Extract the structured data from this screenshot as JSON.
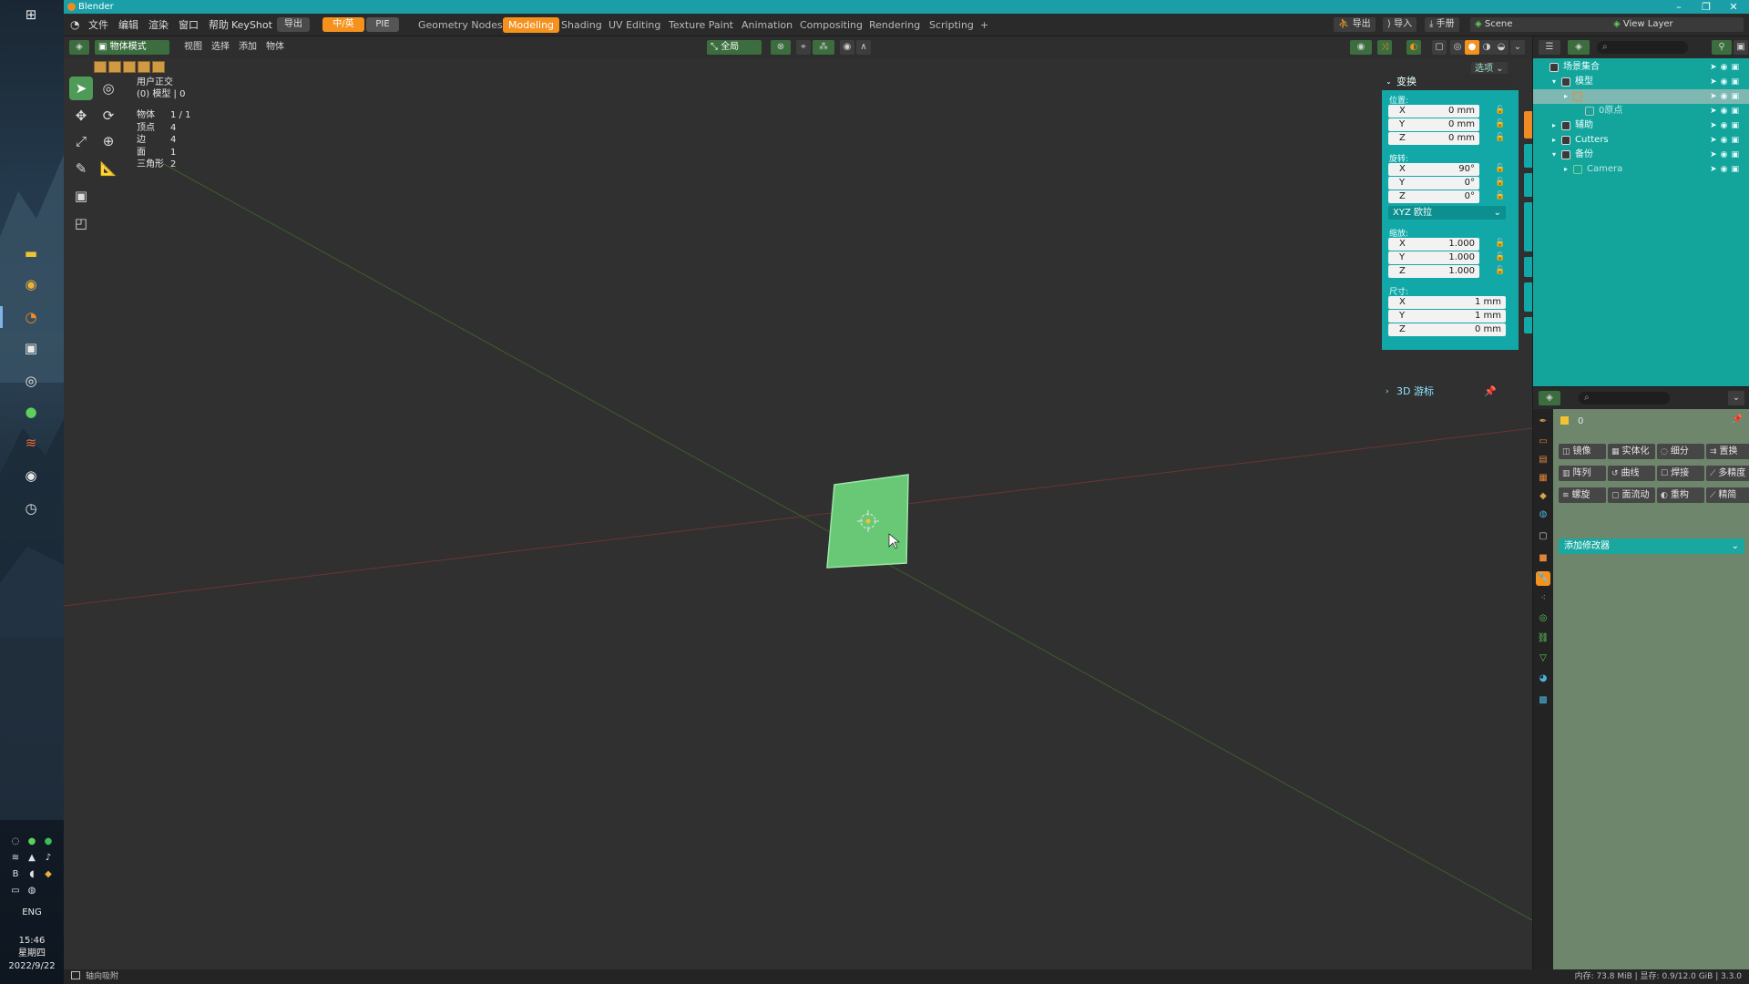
{
  "window": {
    "title": "Blender"
  },
  "taskbar": {
    "lang": "ENG",
    "time": "15:46",
    "weekday": "星期四",
    "date": "2022/9/22"
  },
  "menubar": {
    "items": [
      "文件",
      "编辑",
      "渲染",
      "窗口",
      "帮助",
      "KeyShot"
    ],
    "export_btn": "导出",
    "zh_en_btn": "中/英",
    "pie_btn": "PIE",
    "workspaces": [
      "Geometry Nodes",
      "Modeling",
      "Shading",
      "UV Editing",
      "Texture Paint",
      "Animation",
      "Compositing",
      "Rendering",
      "Scripting",
      "+"
    ],
    "active_workspace": "Modeling",
    "right_export": "导出",
    "right_import": "导入",
    "right_manual": "手册",
    "scene": "Scene",
    "view_layer": "View Layer"
  },
  "viewport_header": {
    "mode": "物体模式",
    "menus": [
      "视图",
      "选择",
      "添加",
      "物体"
    ],
    "orientation": "全局",
    "options": "选项"
  },
  "viewport": {
    "view_name": "用户正交",
    "collection_info": "(0) 模型 | 0",
    "stats": [
      {
        "label": "物体",
        "value": "1 / 1"
      },
      {
        "label": "顶点",
        "value": "4"
      },
      {
        "label": "边",
        "value": "4"
      },
      {
        "label": "面",
        "value": "1"
      },
      {
        "label": "三角形",
        "value": "2"
      }
    ]
  },
  "npanel": {
    "header": "变换",
    "location_label": "位置:",
    "location": [
      {
        "axis": "X",
        "value": "0 mm"
      },
      {
        "axis": "Y",
        "value": "0 mm"
      },
      {
        "axis": "Z",
        "value": "0 mm"
      }
    ],
    "rotation_label": "旋转:",
    "rotation": [
      {
        "axis": "X",
        "value": "90°"
      },
      {
        "axis": "Y",
        "value": "0°"
      },
      {
        "axis": "Z",
        "value": "0°"
      }
    ],
    "rotation_mode": "XYZ 欧拉",
    "scale_label": "缩放:",
    "scale": [
      {
        "axis": "X",
        "value": "1.000"
      },
      {
        "axis": "Y",
        "value": "1.000"
      },
      {
        "axis": "Z",
        "value": "1.000"
      }
    ],
    "dimensions_label": "尺寸:",
    "dimensions": [
      {
        "axis": "X",
        "value": "1 mm"
      },
      {
        "axis": "Y",
        "value": "1 mm"
      },
      {
        "axis": "Z",
        "value": "0 mm"
      }
    ],
    "cursor_section": "3D 游标"
  },
  "outliner": {
    "rows": [
      {
        "name": "场景集合",
        "indent": 0,
        "type": "collection"
      },
      {
        "name": "模型",
        "indent": 1,
        "type": "collection"
      },
      {
        "name": "",
        "indent": 2,
        "type": "mesh",
        "selected": true
      },
      {
        "name": "0原点",
        "indent": 3,
        "type": "empty",
        "dim": true
      },
      {
        "name": "辅助",
        "indent": 1,
        "type": "collection"
      },
      {
        "name": "Cutters",
        "indent": 1,
        "type": "collection"
      },
      {
        "name": "备份",
        "indent": 1,
        "type": "collection"
      },
      {
        "name": "Camera",
        "indent": 2,
        "type": "camera",
        "dim": true
      }
    ]
  },
  "properties": {
    "object_name": "0",
    "modifiers": [
      [
        "镜像",
        "实体化",
        "细分",
        "置换"
      ],
      [
        "阵列",
        "曲线",
        "焊接",
        "多精度"
      ],
      [
        "螺旋",
        "面流动",
        "重构",
        "精简"
      ]
    ],
    "add_modifier": "添加修改器"
  },
  "statusbar": {
    "left": "轴向吸附",
    "right": "内存: 73.8 MiB | 显存: 0.9/12.0 GiB | 3.3.0"
  },
  "colors": {
    "accent_orange": "#f5921e",
    "panel_teal": "#12a8a8",
    "title_teal": "#1a9fa8",
    "plane_green": "#6fcf7c"
  }
}
